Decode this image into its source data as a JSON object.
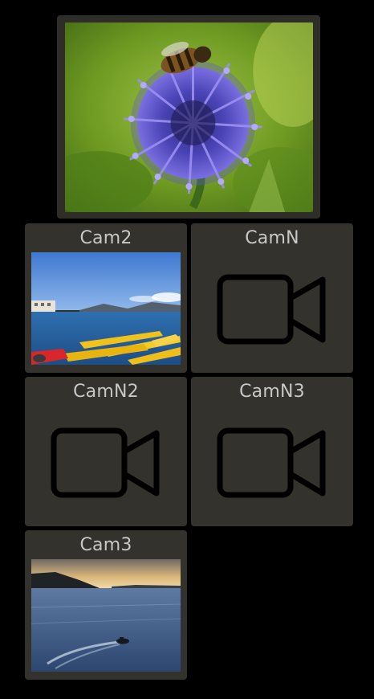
{
  "main_view": {
    "image": "bee-on-purple-flower"
  },
  "cameras": [
    {
      "label": "Cam2",
      "kind": "image",
      "image": "harbor-kayaks"
    },
    {
      "label": "CamN",
      "kind": "placeholder",
      "icon": "video-camera-icon"
    },
    {
      "label": "CamN2",
      "kind": "placeholder",
      "icon": "video-camera-icon"
    },
    {
      "label": "CamN3",
      "kind": "placeholder",
      "icon": "video-camera-icon"
    },
    {
      "label": "Cam3",
      "kind": "image",
      "image": "lake-boat-sunset"
    }
  ],
  "colors": {
    "background": "#000000",
    "tile": "#34322c",
    "label_text": "#c8c8c8",
    "icon_stroke": "#000000"
  }
}
